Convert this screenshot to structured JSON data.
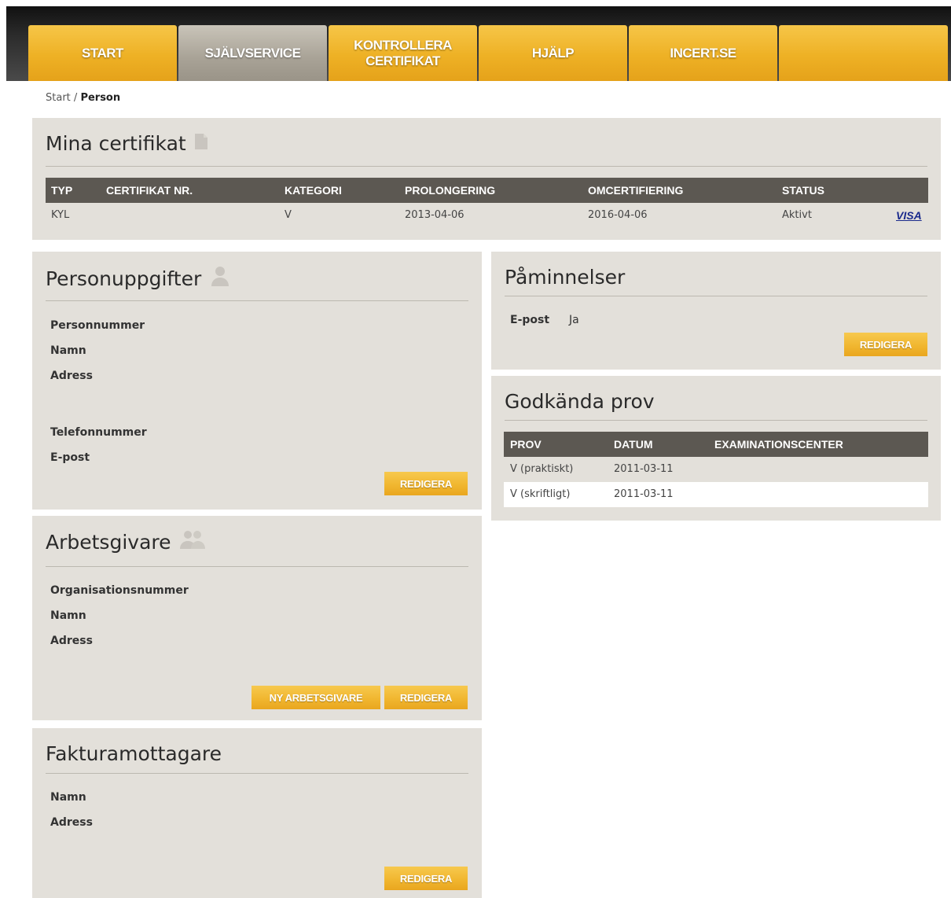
{
  "nav": {
    "tabs": [
      {
        "label": "START"
      },
      {
        "label": "SJÄLVSERVICE"
      },
      {
        "label": "KONTROLLERA CERTIFIKAT"
      },
      {
        "label": "HJÄLP"
      },
      {
        "label": "INCERT.SE"
      }
    ],
    "active_tab": "SJÄLVSERVICE"
  },
  "breadcrumb": {
    "home": "Start",
    "separator": "/",
    "current": "Person"
  },
  "certificates": {
    "title": "Mina certifikat",
    "icon": "document-icon",
    "columns": [
      "TYP",
      "CERTIFIKAT NR.",
      "KATEGORI",
      "PROLONGERING",
      "OMCERTIFIERING",
      "STATUS"
    ],
    "rows": [
      {
        "typ": "KYL",
        "nr": "",
        "kategori": "V",
        "prolongering": "2013-04-06",
        "omcertifiering": "2016-04-06",
        "status": "Aktivt",
        "link": "VISA"
      }
    ]
  },
  "personal": {
    "title": "Personuppgifter",
    "icon": "person-icon",
    "fields": [
      "Personnummer",
      "Namn",
      "Adress",
      "Telefonnummer",
      "E-post"
    ],
    "edit_label": "REDIGERA"
  },
  "employer": {
    "title": "Arbetsgivare",
    "icon": "group-icon",
    "fields": [
      "Organisationsnummer",
      "Namn",
      "Adress"
    ],
    "new_label": "NY ARBETSGIVARE",
    "edit_label": "REDIGERA"
  },
  "invoice": {
    "title": "Fakturamottagare",
    "fields": [
      "Namn",
      "Adress"
    ],
    "edit_label": "REDIGERA"
  },
  "reminders": {
    "title": "Påminnelser",
    "label": "E-post",
    "value": "Ja",
    "edit_label": "REDIGERA"
  },
  "exams": {
    "title": "Godkända prov",
    "columns": [
      "PROV",
      "DATUM",
      "EXAMINATIONSCENTER"
    ],
    "rows": [
      {
        "prov": "V (praktiskt)",
        "datum": "2011-03-11",
        "center": ""
      },
      {
        "prov": "V (skriftligt)",
        "datum": "2011-03-11",
        "center": ""
      }
    ]
  },
  "colors": {
    "accent": "#f0b52e",
    "panel": "#e3e0da",
    "table_header": "#5c5852",
    "active_tab": "#a8a296"
  }
}
